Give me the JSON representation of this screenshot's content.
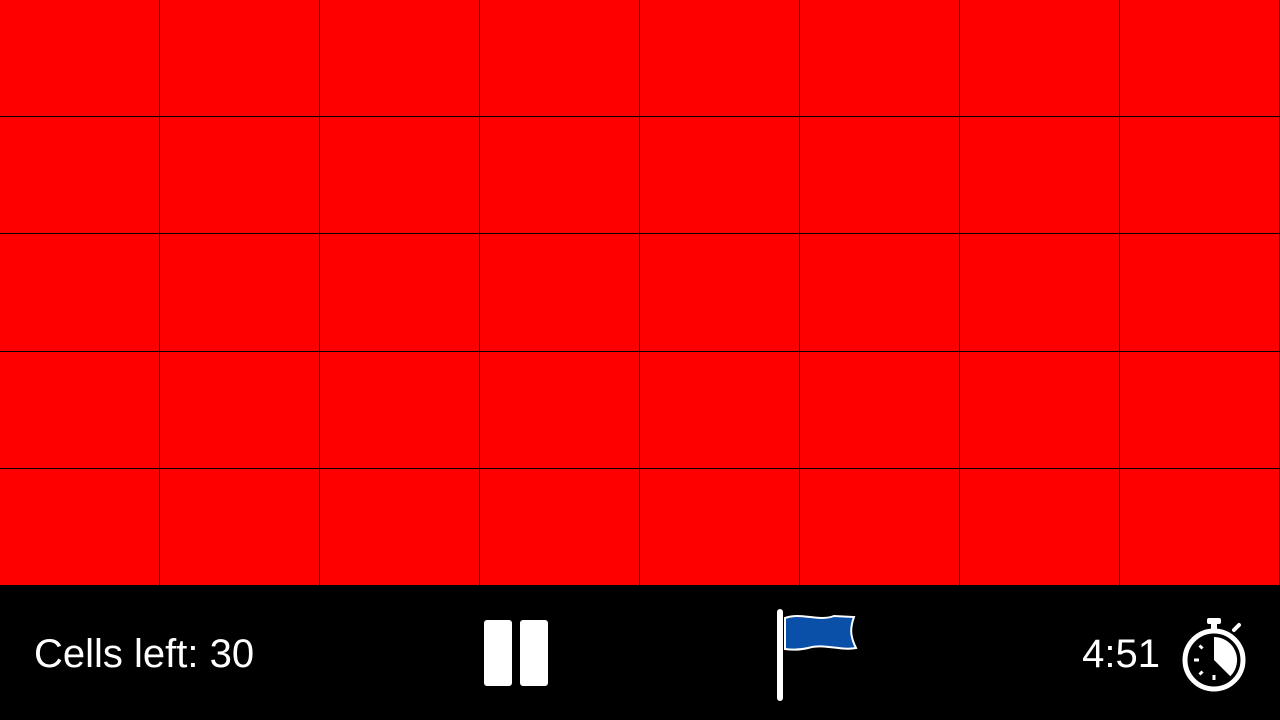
{
  "board": {
    "columns": 8,
    "rows": 5,
    "cell_color": "#ff0000",
    "grid_line_color": "#000000"
  },
  "hud": {
    "cells_left_label": "Cells left: 30",
    "cells_left_count": 30,
    "timer": "4:51",
    "background": "#000000",
    "text_color": "#ffffff"
  },
  "icons": {
    "pause": "pause-icon",
    "flag": "flag-icon",
    "flag_color": "#0a4fa8",
    "stopwatch": "stopwatch-icon"
  }
}
